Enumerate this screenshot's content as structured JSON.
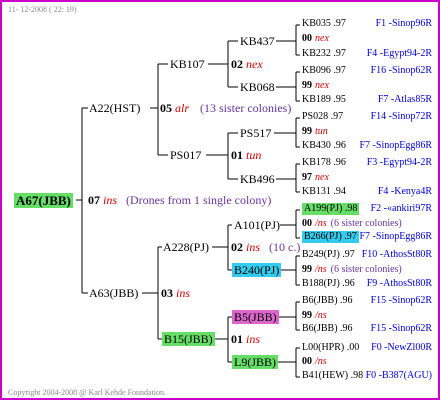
{
  "header": {
    "date": "11- 12-2008 ( 22: 19)"
  },
  "footer": {
    "copyright": "Copyright 2004-2008 @ Karl Kehde Foundation."
  },
  "root": {
    "id": "A67(JBB)",
    "gen": "07",
    "rel": "ins",
    "note": "(Drones from 1 single colony)"
  },
  "p1": {
    "id": "A22(HST)",
    "gen": "05",
    "rel": "alr",
    "note": "(13 sister colonies)"
  },
  "p2": {
    "id": "A63(JBB)",
    "gen": "03",
    "rel": "ins"
  },
  "p11": {
    "id": "KB107",
    "gen": "02",
    "rel": "nex"
  },
  "p12": {
    "id": "PS017",
    "gen": "01",
    "rel": "tun"
  },
  "p21": {
    "id": "A228(PJ)",
    "gen": "02",
    "rel": "ins",
    "note": "(10 c.)"
  },
  "p22": {
    "id": "B15(JBB)",
    "gen": "01",
    "rel": "ins"
  },
  "g": {
    "kb437": "KB437",
    "kb068": "KB068",
    "ps517": "PS517",
    "kb496": "KB496",
    "a101": "A101(PJ)",
    "b240": "B240(PJ)",
    "b5": "B5(JBB)",
    "l9": "L9(JBB)"
  },
  "rows": [
    {
      "left": "KB035 .97",
      "right": "F1 -Sinop96R"
    },
    {
      "gen": "00",
      "rel": "nex"
    },
    {
      "left": "KB232 .97",
      "right": "F4 -Egypt94-2R"
    },
    {
      "left": "KB096 .97",
      "right": "F16 -Sinop62R"
    },
    {
      "gen": "99",
      "rel": "nex"
    },
    {
      "left": "KB189 .95",
      "right": "F7 -Atlas85R"
    },
    {
      "left": "PS028 .97",
      "right": "F14 -Sinop72R"
    },
    {
      "gen": "99",
      "rel": "tun"
    },
    {
      "left": "KB430 .96",
      "right": "F7 -SinopEgg86R"
    },
    {
      "left": "KB178 .96",
      "right": "F3 -Egypt94-2R"
    },
    {
      "gen": "97",
      "rel": "nex"
    },
    {
      "left": "KB131 .94",
      "right": "F4 -Kenya4R"
    },
    {
      "left": "A199(PJ) .98",
      "right": "F2 -«ankiri97R"
    },
    {
      "gen": "00",
      "rel": "/ns",
      "note": "(6 sister colonies)"
    },
    {
      "left": "B266(PJ) .97",
      "right": "F7 -SinopEgg86R"
    },
    {
      "left": "B249(PJ) .97",
      "right": "F10 -AthosSt80R"
    },
    {
      "gen": "99",
      "rel": "/ns",
      "note": "(6 sister colonies)"
    },
    {
      "left": "B188(PJ) .96",
      "right": "F9 -AthosSt80R"
    },
    {
      "left": "B6(JBB) .96",
      "right": "F15 -Sinop62R"
    },
    {
      "gen": "99",
      "rel": "/ns"
    },
    {
      "left": "B6(JBB) .96",
      "right": "F15 -Sinop62R"
    },
    {
      "left": "L00(HPR) .00",
      "right": "F0 -NewZl00R"
    },
    {
      "gen": "00",
      "rel": "/ns"
    },
    {
      "left": "B41(HEW) .98",
      "right": "F0 -B387(AGU)"
    }
  ]
}
